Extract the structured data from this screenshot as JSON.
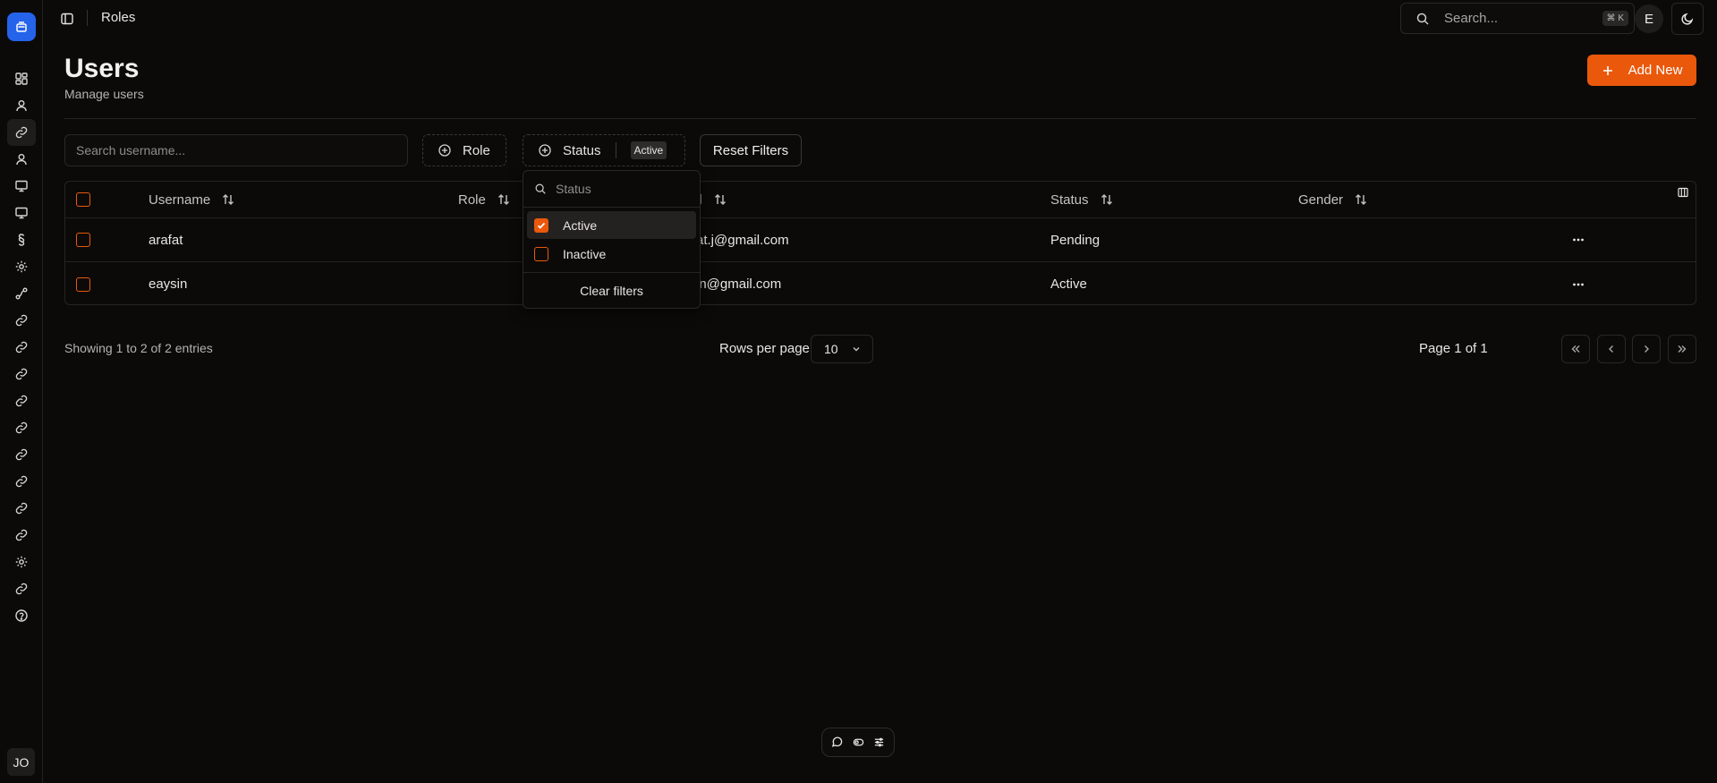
{
  "topbar": {
    "breadcrumb": "Roles",
    "search_placeholder": "Search...",
    "search_shortcut": "⌘ K",
    "user_initial": "E"
  },
  "sidebar": {
    "items": [
      {
        "icon": "dashboard-icon"
      },
      {
        "icon": "user-icon"
      },
      {
        "icon": "link-icon",
        "active": true
      },
      {
        "icon": "user-icon"
      },
      {
        "icon": "monitor-icon"
      },
      {
        "icon": "monitor-icon"
      },
      {
        "icon": "section-icon"
      },
      {
        "icon": "gear-icon"
      },
      {
        "icon": "route-icon"
      },
      {
        "icon": "link-icon"
      },
      {
        "icon": "link-icon"
      },
      {
        "icon": "link-icon"
      },
      {
        "icon": "link-icon"
      },
      {
        "icon": "link-icon"
      },
      {
        "icon": "link-icon"
      },
      {
        "icon": "link-icon"
      },
      {
        "icon": "link-icon"
      },
      {
        "icon": "link-icon"
      },
      {
        "icon": "gear-icon"
      },
      {
        "icon": "link-icon"
      },
      {
        "icon": "help-icon"
      }
    ],
    "avatar_initials": "JO"
  },
  "page": {
    "title": "Users",
    "subtitle": "Manage users",
    "add_button": "Add New"
  },
  "filters": {
    "search_placeholder": "Search username...",
    "role_label": "Role",
    "status_label": "Status",
    "status_chip": "Active",
    "reset_label": "Reset Filters"
  },
  "status_popover": {
    "search_placeholder": "Status",
    "options": [
      {
        "label": "Active",
        "checked": true
      },
      {
        "label": "Inactive",
        "checked": false
      }
    ],
    "clear_label": "Clear filters"
  },
  "table": {
    "columns": [
      "Username",
      "Role",
      "Email",
      "Status",
      "Gender"
    ],
    "header_email_visible": "il",
    "rows": [
      {
        "username": "arafat",
        "role": "",
        "email_visible": "at.j@gmail.com",
        "status": "Pending",
        "gender": ""
      },
      {
        "username": "eaysin",
        "role": "",
        "email_visible": "in@gmail.com",
        "status": "Active",
        "gender": ""
      }
    ]
  },
  "pagination": {
    "info": "Showing 1 to 2 of 2 entries",
    "rows_per_page_label": "Rows per page",
    "rows_per_page_value": "10",
    "page_info": "Page 1 of 1"
  },
  "colors": {
    "accent": "#ea580c",
    "logo": "#2563eb",
    "background": "#0b0a09"
  }
}
